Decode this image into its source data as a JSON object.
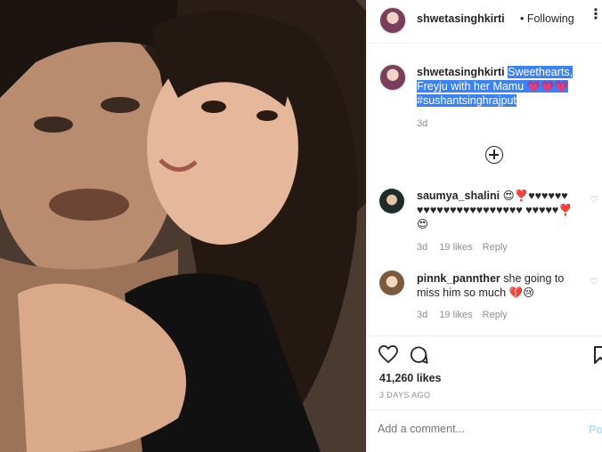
{
  "post": {
    "author": "shwetasinghkirti",
    "follow_status": "• Following",
    "caption_author": "shwetasinghkirti",
    "caption_text": "Sweethearts, Freyju with her Mamu 💗💗💗",
    "caption_hashtag": "#sushantsinghrajput",
    "caption_age": "3d"
  },
  "comments": [
    {
      "user": "saumya_shalini",
      "text": "😍❣️♥♥♥♥♥♥ ♥♥♥♥♥♥♥♥♥♥♥♥♥♥♥♥ ♥♥♥♥♥❣️😍",
      "age": "3d",
      "likes": "19 likes",
      "reply": "Reply"
    },
    {
      "user": "pinnk_pannther",
      "text": "she going to miss him so much 💔😢",
      "age": "3d",
      "likes": "19 likes",
      "reply": "Reply"
    }
  ],
  "stats": {
    "likes": "41,260 likes",
    "time": "3 DAYS AGO"
  },
  "comment_box": {
    "placeholder": "Add a comment...",
    "post_label": "Po"
  },
  "icons": [
    "more-icon",
    "load-more-comments-icon",
    "like-comment-icon",
    "like-icon",
    "comment-icon",
    "bookmark-icon"
  ]
}
